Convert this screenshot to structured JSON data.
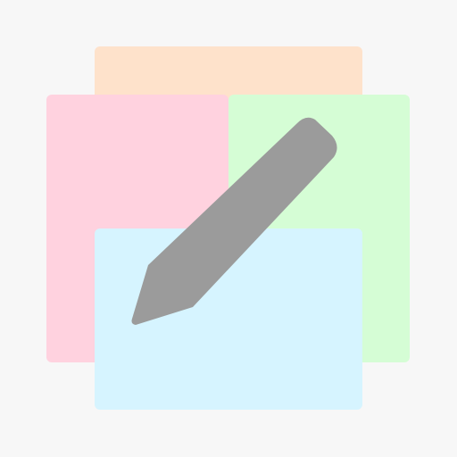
{
  "app_icon": {
    "icon_name": "edit-pencil-icon",
    "colors": {
      "background": "#f7f7f7",
      "card_peach": "#fee2cb",
      "card_green": "#d5fdd5",
      "card_pink": "#ffd2df",
      "card_blue": "#d6f4ff",
      "pencil": "#9b9b9b"
    }
  }
}
